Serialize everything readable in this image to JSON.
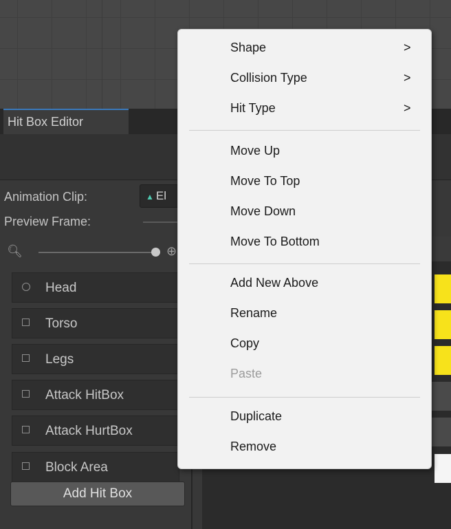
{
  "window": {
    "tab_title": "Hit Box Editor"
  },
  "fields": {
    "animation_clip_label": "Animation Clip:",
    "animation_clip_value": "El",
    "preview_frame_label": "Preview Frame:"
  },
  "icons": {
    "zoom_out": "zoom-out-icon",
    "zoom_in": "zoom-in-icon",
    "clip": "animation-clip-icon"
  },
  "hitboxes": [
    {
      "label": "Head",
      "shape": "circle"
    },
    {
      "label": "Torso",
      "shape": "box"
    },
    {
      "label": "Legs",
      "shape": "box"
    },
    {
      "label": "Attack HitBox",
      "shape": "box"
    },
    {
      "label": "Attack HurtBox",
      "shape": "box"
    },
    {
      "label": "Block Area",
      "shape": "box"
    }
  ],
  "add_button": "Add Hit Box",
  "context_menu": {
    "groups": [
      [
        {
          "label": "Shape",
          "submenu": true,
          "enabled": true
        },
        {
          "label": "Collision Type",
          "submenu": true,
          "enabled": true
        },
        {
          "label": "Hit Type",
          "submenu": true,
          "enabled": true
        }
      ],
      [
        {
          "label": "Move Up",
          "submenu": false,
          "enabled": true
        },
        {
          "label": "Move To Top",
          "submenu": false,
          "enabled": true
        },
        {
          "label": "Move Down",
          "submenu": false,
          "enabled": true
        },
        {
          "label": "Move To Bottom",
          "submenu": false,
          "enabled": true
        }
      ],
      [
        {
          "label": "Add New Above",
          "submenu": false,
          "enabled": true
        },
        {
          "label": "Rename",
          "submenu": false,
          "enabled": true
        },
        {
          "label": "Copy",
          "submenu": false,
          "enabled": true
        },
        {
          "label": "Paste",
          "submenu": false,
          "enabled": false
        }
      ],
      [
        {
          "label": "Duplicate",
          "submenu": false,
          "enabled": true
        },
        {
          "label": "Remove",
          "submenu": false,
          "enabled": true
        }
      ]
    ],
    "submenu_glyph": ">"
  },
  "colors": {
    "accent_tab": "#3a79bb",
    "timeline_yellow": "#f7e21b",
    "clip_icon": "#4ec9b0"
  }
}
